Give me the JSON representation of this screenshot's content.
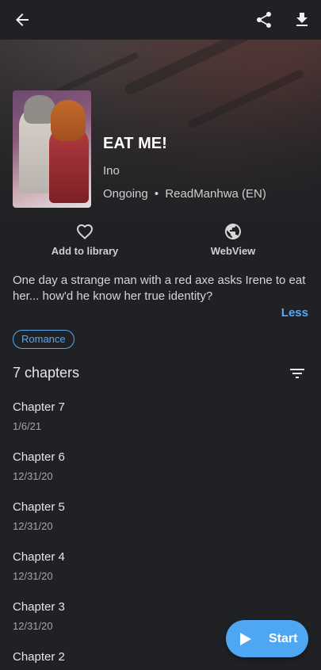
{
  "manga": {
    "title": "EAT ME!",
    "author": "Ino",
    "status": "Ongoing",
    "separator": "•",
    "source": "ReadManhwa (EN)"
  },
  "actions": {
    "library_label": "Add to library",
    "webview_label": "WebView"
  },
  "description": {
    "text": "One day a strange man with a red axe asks Irene to eat her... how'd he know her true identity?",
    "toggle_label": "Less"
  },
  "tags": [
    "Romance"
  ],
  "chapters": {
    "count_label": "7 chapters",
    "items": [
      {
        "name": "Chapter 7",
        "date": "1/6/21"
      },
      {
        "name": "Chapter 6",
        "date": "12/31/20"
      },
      {
        "name": "Chapter 5",
        "date": "12/31/20"
      },
      {
        "name": "Chapter 4",
        "date": "12/31/20"
      },
      {
        "name": "Chapter 3",
        "date": "12/31/20"
      },
      {
        "name": "Chapter 2",
        "date": ""
      }
    ]
  },
  "fab": {
    "label": "Start"
  },
  "icons": {
    "back": "arrow-back-icon",
    "share": "share-icon",
    "download": "download-icon",
    "heart": "heart-outline-icon",
    "globe": "globe-icon",
    "filter": "filter-icon",
    "play": "play-icon"
  },
  "colors": {
    "background": "#1f2124",
    "accent": "#59a9f0",
    "fab": "#4fa6f2"
  }
}
